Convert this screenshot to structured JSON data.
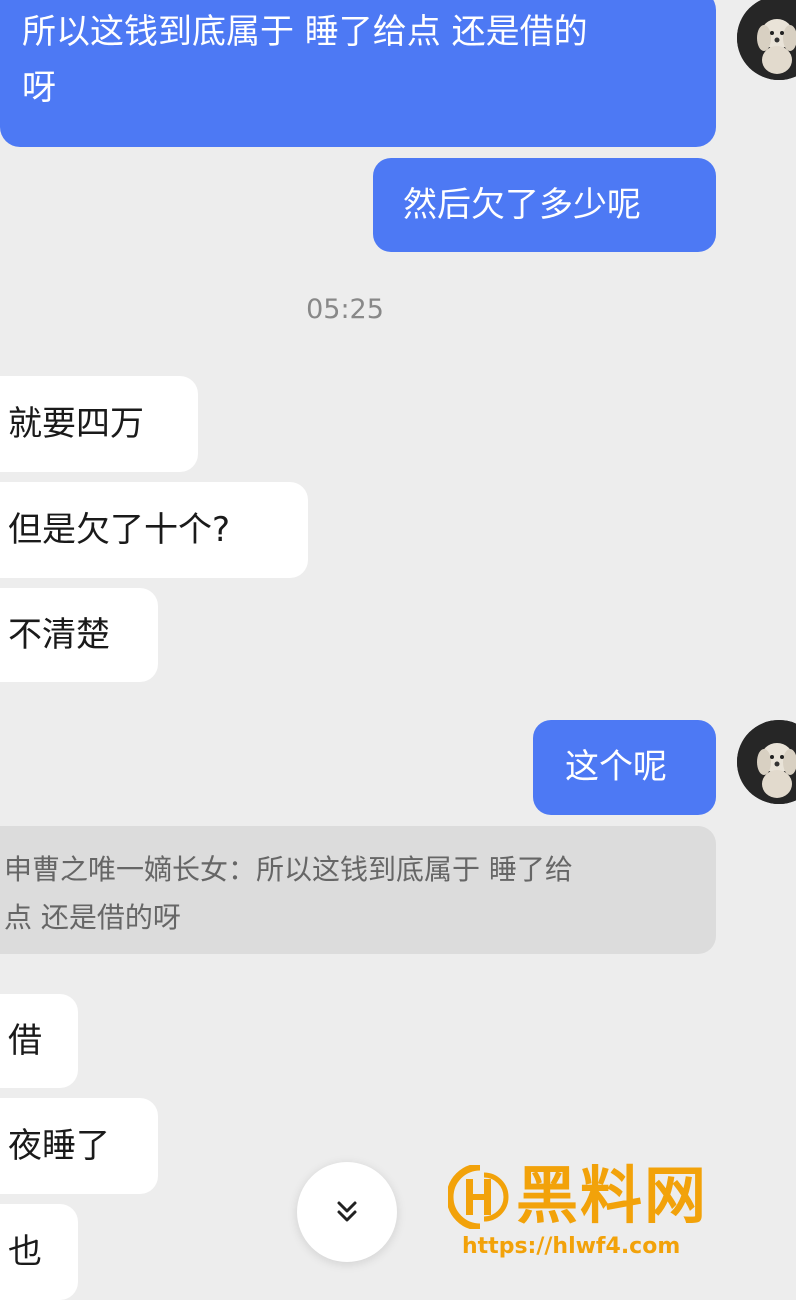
{
  "messages": {
    "out1_line1": "所以这钱到底属于 睡了给点 还是借的",
    "out1_line2": "呀",
    "out2": "然后欠了多少呢",
    "timestamp": "05:25",
    "in1": "就要四万",
    "in2": "但是欠了十个?",
    "in3": "不清楚",
    "out3": "这个呢",
    "quote_line1": "申曹之唯一嫡长女：所以这钱到底属于 睡了给",
    "quote_line2": "点 还是借的呀",
    "in4": "借",
    "in5": "夜睡了",
    "in6": "也"
  },
  "icons": {
    "avatar": "dog-avatar",
    "scroll": "double-chevron-down-icon",
    "watermark_logo": "hl-logo-icon"
  },
  "watermark": {
    "title": "黑料网",
    "url": "https://hlwf4.com"
  },
  "colors": {
    "outgoing_bubble": "#4d79f4",
    "incoming_bubble": "#ffffff",
    "background": "#ededed",
    "quote_background": "#dcdcdc",
    "watermark": "#f2a20a"
  }
}
